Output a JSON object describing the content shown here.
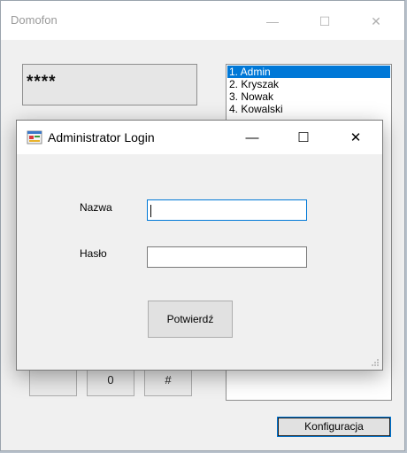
{
  "main_window": {
    "title": "Domofon",
    "controls": {
      "minimize": "—",
      "maximize": "☐",
      "close": "✕"
    },
    "display": "****",
    "users": [
      {
        "label": "1. Admin",
        "selected": true
      },
      {
        "label": "2. Kryszak",
        "selected": false
      },
      {
        "label": "3. Nowak",
        "selected": false
      },
      {
        "label": "4. Kowalski",
        "selected": false
      }
    ],
    "keypad": [
      "",
      "0",
      "#"
    ],
    "config_button": "Konfiguracja"
  },
  "dialog": {
    "title": "Administrator Login",
    "controls": {
      "minimize": "—",
      "maximize": "☐",
      "close": "✕"
    },
    "name_label": "Nazwa",
    "name_value": "",
    "password_label": "Hasło",
    "password_value": "",
    "confirm_button": "Potwierdź"
  },
  "colors": {
    "selection": "#0078d7",
    "window_bg": "#f0f0f0"
  }
}
